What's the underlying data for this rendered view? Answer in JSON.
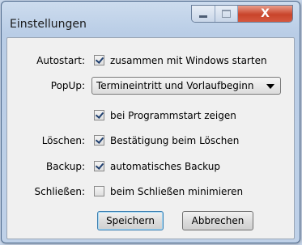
{
  "window": {
    "title": "Einstellungen",
    "close_glyph": "X"
  },
  "form": {
    "autostart": {
      "label": "Autostart:",
      "checkbox_label": "zusammen mit Windows starten",
      "checked": true
    },
    "popup": {
      "label": "PopUp:",
      "selected": "Termineintritt und Vorlaufbeginn",
      "show_on_start": {
        "checkbox_label": "bei Programmstart zeigen",
        "checked": true
      }
    },
    "delete": {
      "label": "Löschen:",
      "checkbox_label": "Bestätigung beim Löschen",
      "checked": true
    },
    "backup": {
      "label": "Backup:",
      "checkbox_label": "automatisches Backup",
      "checked": true
    },
    "close": {
      "label": "Schließen:",
      "checkbox_label": "beim Schließen minimieren",
      "checked": false
    }
  },
  "buttons": {
    "save": "Speichern",
    "cancel": "Abbrechen"
  }
}
